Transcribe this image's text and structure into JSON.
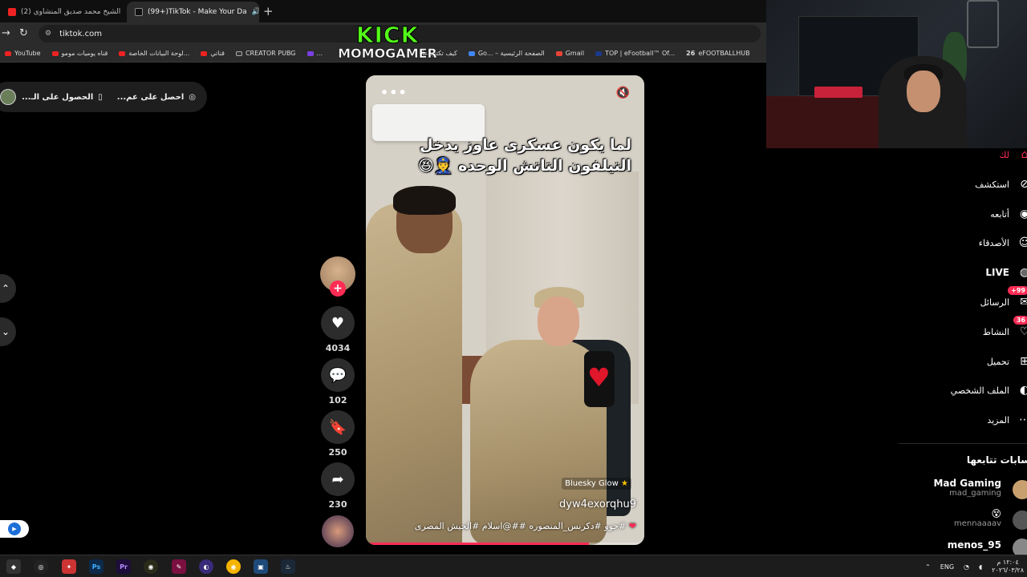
{
  "browser": {
    "tabs": [
      {
        "title": "(2) الشيخ محمد صديق المنشاوى",
        "active": false
      },
      {
        "title": "(99+)TikTok - Make Your Da",
        "active": true
      }
    ],
    "url": "tiktok.com",
    "bookmarks": [
      "YouTube",
      "قناه يوميات مومو",
      "لوحة البيانات الخاصة...",
      "قناتي",
      "CREATOR PUBG",
      "...",
      "كيف تكتب عا",
      "Go... – الصفحة الرئيسية",
      "Gmail",
      "TOP | eFootball™ Of...",
      "eFOOTBALLHUB"
    ]
  },
  "overlay": {
    "line1": "KICK",
    "line2": "MOMOGAMER"
  },
  "pill": {
    "item1": "احصل على عم...",
    "item2": "الحصول على الـ..."
  },
  "video": {
    "caption_line1": "لما يكون عسكرى عاوز يدخل",
    "caption_line2": "التيلفون التاتش الوحده 👮‍♂️😆",
    "effect": "Bluesky Glow",
    "username": "dyw4exorqhu9",
    "description": "#جوو #دكرنس_المنصوره ##@اسلام #الجيش المصرى",
    "progress": 0.8
  },
  "actions": {
    "likes": "4034",
    "comments": "102",
    "saves": "250",
    "shares": "230"
  },
  "sidebar": {
    "items": [
      {
        "label": "لك",
        "icon": "home-icon"
      },
      {
        "label": "استكشف",
        "icon": "compass-icon"
      },
      {
        "label": "أتابعه",
        "icon": "following-icon"
      },
      {
        "label": "الأصدقاء",
        "icon": "friends-icon"
      },
      {
        "label": "LIVE",
        "icon": "live-icon"
      },
      {
        "label": "الرسائل",
        "icon": "messages-icon",
        "badge": "99+"
      },
      {
        "label": "النشاط",
        "icon": "activity-icon",
        "badge": "36"
      },
      {
        "label": "تحميل",
        "icon": "upload-icon"
      },
      {
        "label": "الملف الشخصي",
        "icon": "profile-icon"
      },
      {
        "label": "المزيد",
        "icon": "more-icon"
      }
    ],
    "following_heading": "سابات تتابعها",
    "following": [
      {
        "name": "Mad Gaming",
        "user": "mad_gaming"
      },
      {
        "name": "😵",
        "user": "mennaaaav"
      },
      {
        "name": "menos_95",
        "user": ""
      }
    ]
  },
  "taskbar": {
    "lang": "ENG",
    "time": "١٢:٠٤ م",
    "date": "٢٠٢٦/٠٣/٢٨"
  },
  "colors": {
    "accent": "#fe2c55",
    "kick": "#53fc18"
  }
}
